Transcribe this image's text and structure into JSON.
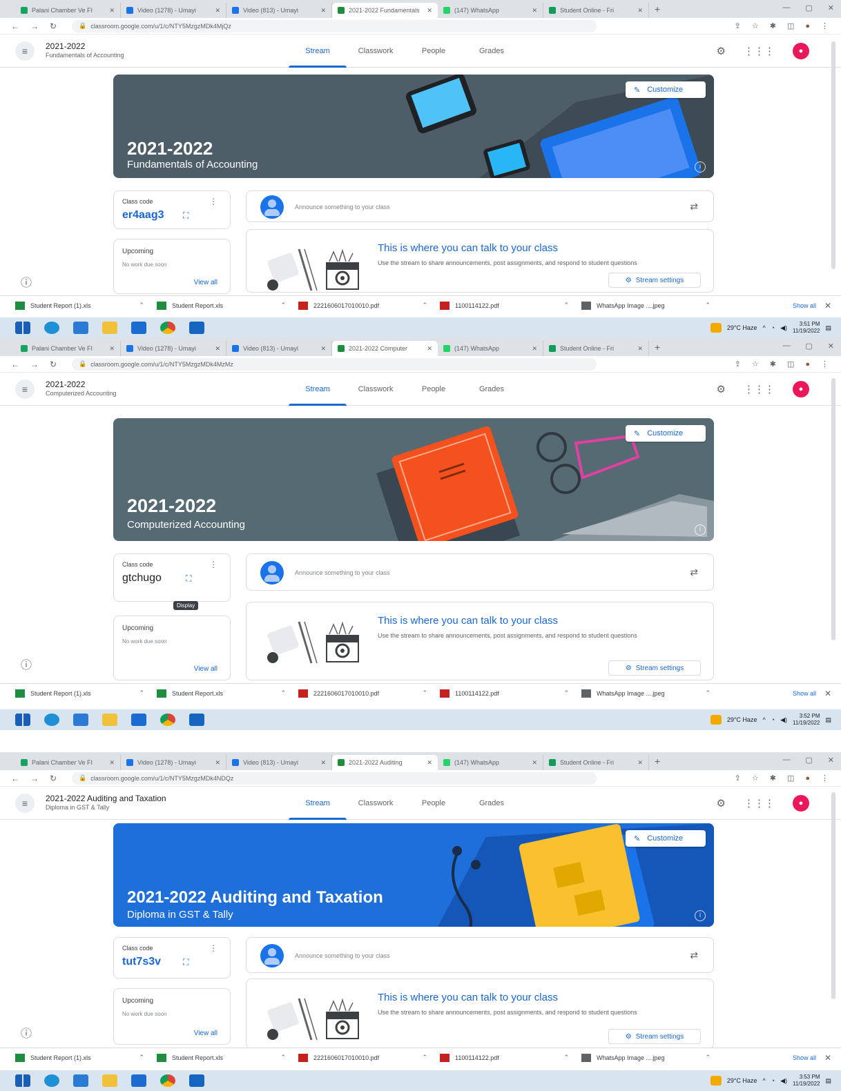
{
  "shots": [
    {
      "tabs": [
        {
          "label": "Palani Chamber Ve FI",
          "icon": "drive-icon"
        },
        {
          "label": "Video (1278) - Umayi",
          "icon": "video-icon"
        },
        {
          "label": "Video (813) - Umayi",
          "icon": "video-icon"
        },
        {
          "label": "2021-2022 Fundamentals",
          "icon": "classroom-icon",
          "active": true
        },
        {
          "label": "(147) WhatsApp",
          "icon": "whatsapp-icon"
        },
        {
          "label": "Student Online - Fri",
          "icon": "chrome-icon"
        }
      ],
      "url": "classroom.google.com/u/1/c/NTY5MzgzMDk4MjQz",
      "class_title": "2021-2022",
      "class_subtitle": "Fundamentals of Accounting",
      "nav": [
        "Stream",
        "Classwork",
        "People",
        "Grades"
      ],
      "banner_title": "2021-2022",
      "banner_subtitle": "Fundamentals of Accounting",
      "customize": "Customize",
      "class_code_label": "Class code",
      "class_code": "er4aag3",
      "upcoming_label": "Upcoming",
      "upcoming_none": "No work due soon",
      "view_all": "View all",
      "announce_placeholder": "Announce something to your class",
      "talk_title": "This is where you can talk to your class",
      "talk_desc": "Use the stream to share announcements, post assignments, and respond to student questions",
      "stream_settings": "Stream settings",
      "downloads": [
        "Student Report (1).xls",
        "Student Report.xls",
        "2221606017010010.pdf",
        "1100114122.pdf",
        "WhatsApp Image ....jpeg"
      ],
      "show_all": "Show all",
      "weather": "29°C Haze",
      "time": "3:51 PM",
      "date": "11/19/2022"
    },
    {
      "tabs": [
        {
          "label": "Palani Chamber Ve FI",
          "icon": "drive-icon"
        },
        {
          "label": "Video (1278) - Umayi",
          "icon": "video-icon"
        },
        {
          "label": "Video (813) - Umayi",
          "icon": "video-icon"
        },
        {
          "label": "2021-2022 Computer",
          "icon": "classroom-icon",
          "active": true
        },
        {
          "label": "(147) WhatsApp",
          "icon": "whatsapp-icon"
        },
        {
          "label": "Student Online - Fri",
          "icon": "chrome-icon"
        }
      ],
      "url": "classroom.google.com/u/1/c/NTY5MzgzMDk4MzMz",
      "class_title": "2021-2022",
      "class_subtitle": "Computerized Accounting",
      "nav": [
        "Stream",
        "Classwork",
        "People",
        "Grades"
      ],
      "banner_title": "2021-2022",
      "banner_subtitle": "Computerized Accounting",
      "customize": "Customize",
      "class_code_label": "Class code",
      "class_code": "gtchugo",
      "tooltip": "Display",
      "upcoming_label": "Upcoming",
      "upcoming_none": "No work due soon",
      "view_all": "View all",
      "announce_placeholder": "Announce something to your class",
      "talk_title": "This is where you can talk to your class",
      "talk_desc": "Use the stream to share announcements, post assignments, and respond to student questions",
      "stream_settings": "Stream settings",
      "downloads": [
        "Student Report (1).xls",
        "Student Report.xls",
        "2221606017010010.pdf",
        "1100114122.pdf",
        "WhatsApp Image ....jpeg"
      ],
      "show_all": "Show all",
      "weather": "29°C Haze",
      "time": "3:52 PM",
      "date": "11/19/2022"
    },
    {
      "tabs": [
        {
          "label": "Palani Chamber Ve FI",
          "icon": "drive-icon"
        },
        {
          "label": "Video (1278) - Umayi",
          "icon": "video-icon"
        },
        {
          "label": "Video (813) - Umayi",
          "icon": "video-icon"
        },
        {
          "label": "2021-2022 Auditing",
          "icon": "classroom-icon",
          "active": true
        },
        {
          "label": "(147) WhatsApp",
          "icon": "whatsapp-icon"
        },
        {
          "label": "Student Online - Fri",
          "icon": "chrome-icon"
        }
      ],
      "url": "classroom.google.com/u/1/c/NTY5MzgzMDk4NDQz",
      "class_title": "2021-2022 Auditing and Taxation",
      "class_subtitle": "Diploma in GST & Tally",
      "nav": [
        "Stream",
        "Classwork",
        "People",
        "Grades"
      ],
      "banner_title": "2021-2022 Auditing and Taxation",
      "banner_subtitle": "Diploma in GST & Tally",
      "customize": "Customize",
      "class_code_label": "Class code",
      "class_code": "tut7s3v",
      "upcoming_label": "Upcoming",
      "upcoming_none": "No work due soon",
      "view_all": "View all",
      "announce_placeholder": "Announce something to your class",
      "talk_title": "This is where you can talk to your class",
      "talk_desc": "Use the stream to share announcements, post assignments, and respond to student questions",
      "stream_settings": "Stream settings",
      "downloads": [
        "Student Report (1).xls",
        "Student Report.xls",
        "2221606017010010.pdf",
        "1100114122.pdf",
        "WhatsApp Image ....jpeg"
      ],
      "show_all": "Show all",
      "weather": "29°C Haze",
      "time": "3:53 PM",
      "date": "11/19/2022"
    }
  ],
  "colors": {
    "banner_1": "#4e5e69",
    "banner_2": "#566a74",
    "banner_3": "#1e6fd9",
    "accent": "#1967d2",
    "profile": "#e8185b"
  }
}
